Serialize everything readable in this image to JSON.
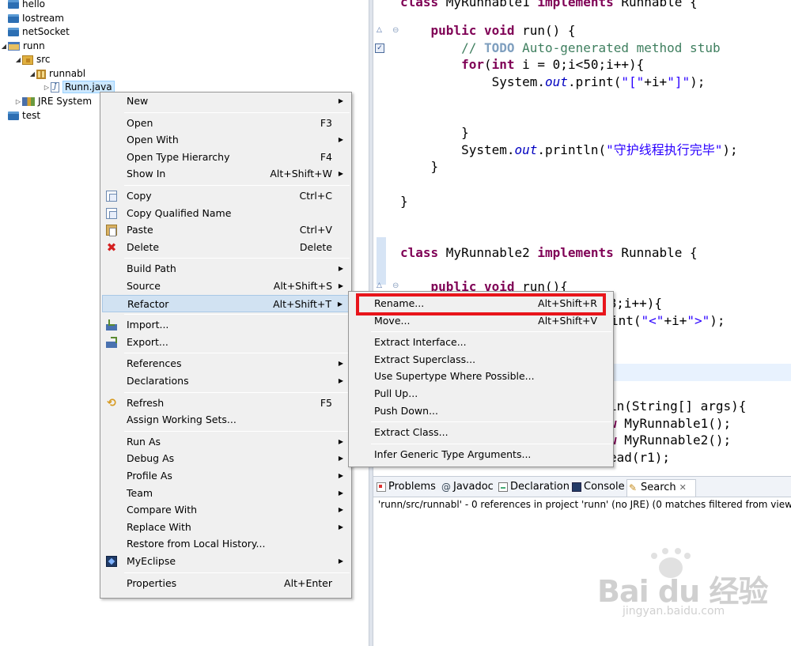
{
  "tree": {
    "items": [
      {
        "label": "hello",
        "icon": "project-icon"
      },
      {
        "label": "Iostream",
        "icon": "project-icon"
      },
      {
        "label": "netSocket",
        "icon": "project-icon"
      },
      {
        "label": "runn",
        "icon": "project-open-icon",
        "twisty": "◢"
      },
      {
        "label": "src",
        "icon": "source-folder-icon",
        "twisty": "◢"
      },
      {
        "label": "runnabl",
        "icon": "package-icon",
        "twisty": "◢"
      },
      {
        "label": "Runn.java",
        "icon": "java-file-icon",
        "twisty": "▷",
        "selected": true
      },
      {
        "label": "JRE System",
        "icon": "library-icon",
        "twisty": "▷"
      },
      {
        "label": "test",
        "icon": "project-icon"
      }
    ]
  },
  "editor": {
    "lines": [
      {
        "segments": [
          {
            "t": "class ",
            "c": "kw"
          },
          {
            "t": "MyRunnable1 ",
            "c": ""
          },
          {
            "t": "implements ",
            "c": "kw"
          },
          {
            "t": "Runnable {",
            "c": ""
          }
        ]
      },
      {
        "segments": [
          {
            "t": "    ",
            "c": ""
          },
          {
            "t": "public void ",
            "c": "kw"
          },
          {
            "t": "run() {",
            "c": ""
          }
        ]
      },
      {
        "segments": [
          {
            "t": "        // ",
            "c": "cm"
          },
          {
            "t": "TODO",
            "c": "cm-todo"
          },
          {
            "t": " Auto-generated method stub",
            "c": "cm"
          }
        ]
      },
      {
        "segments": [
          {
            "t": "        ",
            "c": ""
          },
          {
            "t": "for",
            "c": "kw"
          },
          {
            "t": "(",
            "c": ""
          },
          {
            "t": "int ",
            "c": "kw"
          },
          {
            "t": "i = 0;i<50;i++){",
            "c": ""
          }
        ]
      },
      {
        "segments": [
          {
            "t": "            System.",
            "c": ""
          },
          {
            "t": "out",
            "c": "fld"
          },
          {
            "t": ".print(",
            "c": ""
          },
          {
            "t": "\"[\"",
            "c": "st"
          },
          {
            "t": "+i+",
            "c": ""
          },
          {
            "t": "\"]\"",
            "c": "st"
          },
          {
            "t": ");",
            "c": ""
          }
        ]
      },
      {
        "segments": [
          {
            "t": "        }",
            "c": ""
          }
        ]
      },
      {
        "segments": [
          {
            "t": "        System.",
            "c": ""
          },
          {
            "t": "out",
            "c": "fld"
          },
          {
            "t": ".println(",
            "c": ""
          },
          {
            "t": "\"守护线程执行完毕\"",
            "c": "st"
          },
          {
            "t": ");",
            "c": ""
          }
        ]
      },
      {
        "segments": [
          {
            "t": "    }",
            "c": ""
          }
        ]
      },
      {
        "segments": [
          {
            "t": "}",
            "c": ""
          }
        ]
      },
      {
        "segments": [
          {
            "t": "class ",
            "c": "kw"
          },
          {
            "t": "MyRunnable2 ",
            "c": ""
          },
          {
            "t": "implements ",
            "c": "kw"
          },
          {
            "t": "Runnable {",
            "c": ""
          }
        ]
      },
      {
        "segments": [
          {
            "t": "    ",
            "c": ""
          },
          {
            "t": "public void ",
            "c": "kw"
          },
          {
            "t": "run(){",
            "c": ""
          }
        ]
      },
      {
        "segments": [
          {
            "t": "88;i++){",
            "c": ""
          }
        ]
      },
      {
        "segments": [
          {
            "t": "int(",
            "c": ""
          },
          {
            "t": "\"<\"",
            "c": "st"
          },
          {
            "t": "+i+",
            "c": ""
          },
          {
            "t": "\">\"",
            "c": "st"
          },
          {
            "t": ");",
            "c": ""
          }
        ]
      },
      {
        "segments": [
          {
            "t": "in(String[] args){",
            "c": ""
          }
        ]
      },
      {
        "segments": [
          {
            "t": "w ",
            "c": "kw"
          },
          {
            "t": "MyRunnable1();",
            "c": ""
          }
        ]
      },
      {
        "segments": [
          {
            "t": "w ",
            "c": "kw"
          },
          {
            "t": "MyRunnable2();",
            "c": ""
          }
        ]
      },
      {
        "segments": [
          {
            "t": "ead(r1);",
            "c": ""
          }
        ]
      }
    ]
  },
  "views": {
    "tabs": [
      {
        "label": "Problems",
        "icon": "problems-icon"
      },
      {
        "label": "Javadoc",
        "icon": "javadoc-icon",
        "glyph": "@"
      },
      {
        "label": "Declaration",
        "icon": "declaration-icon"
      },
      {
        "label": "Console",
        "icon": "console-icon"
      },
      {
        "label": "Search",
        "icon": "search-icon",
        "glyph": "✎",
        "active": true,
        "close": "✕"
      }
    ],
    "search_status": "'runn/src/runnabl' - 0 references in project 'runn' (no JRE) (0 matches filtered from view)"
  },
  "context_menu": {
    "items": [
      {
        "label": "New",
        "submenu": true
      },
      {
        "separator": true
      },
      {
        "label": "Open",
        "shortcut": "F3"
      },
      {
        "label": "Open With",
        "submenu": true
      },
      {
        "label": "Open Type Hierarchy",
        "shortcut": "F4"
      },
      {
        "label": "Show In",
        "shortcut": "Alt+Shift+W",
        "submenu": true
      },
      {
        "separator": true
      },
      {
        "label": "Copy",
        "shortcut": "Ctrl+C",
        "icon": "copy-icon"
      },
      {
        "label": "Copy Qualified Name",
        "icon": "copy-qualified-icon"
      },
      {
        "label": "Paste",
        "shortcut": "Ctrl+V",
        "icon": "paste-icon"
      },
      {
        "label": "Delete",
        "shortcut": "Delete",
        "icon": "delete-icon"
      },
      {
        "separator": true
      },
      {
        "label": "Build Path",
        "submenu": true
      },
      {
        "label": "Source",
        "shortcut": "Alt+Shift+S",
        "submenu": true
      },
      {
        "label": "Refactor",
        "shortcut": "Alt+Shift+T",
        "submenu": true,
        "hover": true
      },
      {
        "separator": true
      },
      {
        "label": "Import...",
        "icon": "import-icon"
      },
      {
        "label": "Export...",
        "icon": "export-icon"
      },
      {
        "separator": true
      },
      {
        "label": "References",
        "submenu": true
      },
      {
        "label": "Declarations",
        "submenu": true
      },
      {
        "separator": true
      },
      {
        "label": "Refresh",
        "shortcut": "F5",
        "icon": "refresh-icon"
      },
      {
        "label": "Assign Working Sets..."
      },
      {
        "separator": true
      },
      {
        "label": "Run As",
        "submenu": true
      },
      {
        "label": "Debug As",
        "submenu": true
      },
      {
        "label": "Profile As",
        "submenu": true
      },
      {
        "label": "Team",
        "submenu": true
      },
      {
        "label": "Compare With",
        "submenu": true
      },
      {
        "label": "Replace With",
        "submenu": true
      },
      {
        "label": "Restore from Local History..."
      },
      {
        "label": "MyEclipse",
        "submenu": true,
        "icon": "myeclipse-icon"
      },
      {
        "separator": true
      },
      {
        "label": "Properties",
        "shortcut": "Alt+Enter"
      }
    ]
  },
  "refactor_submenu": {
    "items": [
      {
        "label": "Rename...",
        "shortcut": "Alt+Shift+R",
        "highlighted": true
      },
      {
        "label": "Move...",
        "shortcut": "Alt+Shift+V"
      },
      {
        "separator": true
      },
      {
        "label": "Extract Interface..."
      },
      {
        "label": "Extract Superclass..."
      },
      {
        "label": "Use Supertype Where Possible..."
      },
      {
        "label": "Pull Up..."
      },
      {
        "label": "Push Down..."
      },
      {
        "separator": true
      },
      {
        "label": "Extract Class..."
      },
      {
        "separator": true
      },
      {
        "label": "Infer Generic Type Arguments..."
      }
    ]
  },
  "watermark": {
    "brand": "Bai du 经验",
    "url": "jingyan.baidu.com"
  },
  "colors": {
    "highlight_box": "#e8151b",
    "menu_hover": "#d1e2f2",
    "keyword": "#7f0055",
    "string": "#2a00ff",
    "comment": "#3f7f5f"
  }
}
